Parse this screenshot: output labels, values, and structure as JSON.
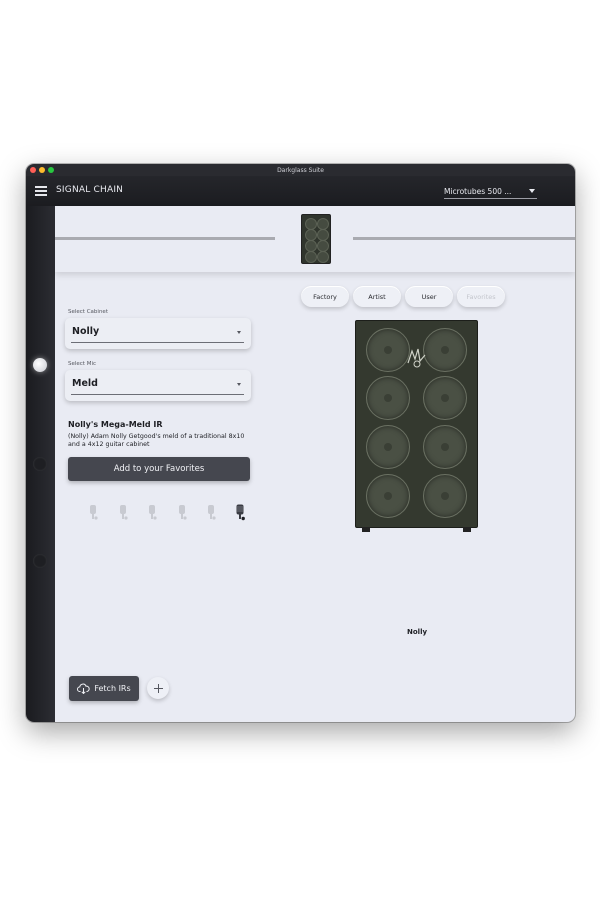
{
  "window": {
    "title": "Darkglass Suite"
  },
  "appbar": {
    "title": "SIGNAL CHAIN",
    "preset": "Microtubes 500 ..."
  },
  "filters": [
    {
      "label": "Factory",
      "active": true
    },
    {
      "label": "Artist",
      "active": true
    },
    {
      "label": "User",
      "active": true
    },
    {
      "label": "Favorites",
      "active": false
    }
  ],
  "cabinet": {
    "label": "Select Cabinet",
    "value": "Nolly"
  },
  "mic": {
    "label": "Select Mic",
    "value": "Meld"
  },
  "ir": {
    "title": "Nolly's Mega-Meld IR",
    "description": "(Nolly) Adam Nolly Getgood's meld of a traditional 8x10 and a 4x12 guitar cabinet"
  },
  "favorites_button": "Add to your Favorites",
  "selected_cabinet_name": "Nolly",
  "fetch_button": "Fetch IRs",
  "mic_icons": [
    "mic-1-icon",
    "mic-2-icon",
    "mic-3-icon",
    "mic-4-icon",
    "mic-5-icon",
    "mic-6-icon"
  ],
  "colors": {
    "accent_dark": "#45474f",
    "cabinet_green": "#34392f",
    "background": "#e9ebf3"
  }
}
